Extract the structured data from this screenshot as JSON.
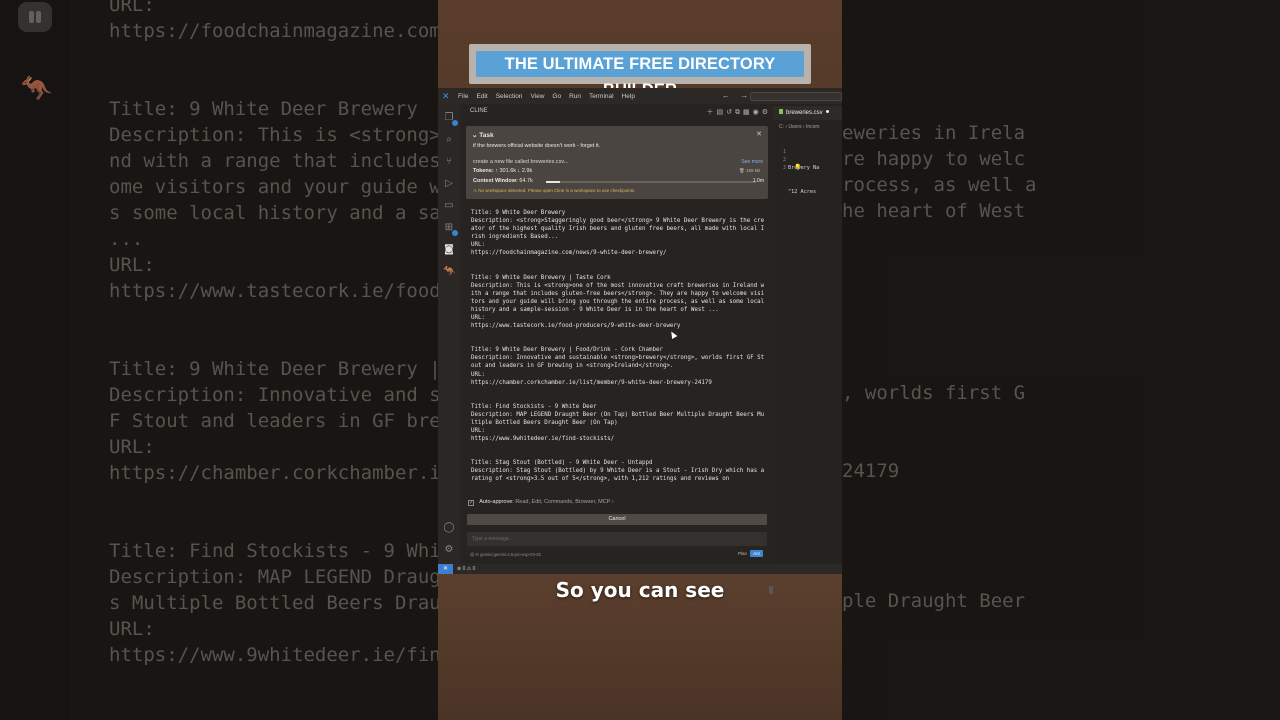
{
  "headline": "THE ULTIMATE FREE DIRECTORY BUILDER",
  "caption": "So you can see",
  "background": {
    "left_lines": [
      "URL:",
      "https://foodchainmagazine.com",
      "",
      "",
      "Title: 9 White Deer Brewery",
      "Description: This is <strong>",
      "nd with a range that includes",
      "ome visitors and your guide w",
      "s some local history and a sa",
      "...",
      "URL:",
      "https://www.tastecork.ie/food",
      "",
      "",
      "Title: 9 White Deer Brewery |",
      "Description: Innovative and s",
      "F Stout and leaders in GF bre",
      "URL:",
      "https://chamber.corkchamber.i",
      "",
      "",
      "Title: Find Stockists - 9 Whi",
      "Description: MAP LEGEND Draug",
      "s Multiple Bottled Beers Drau",
      "URL:",
      "https://www.9whitedeer.ie/fin"
    ],
    "right_lines": [
      "eweries in Irela",
      "re happy to welc",
      "rocess, as well a",
      "he heart of West",
      "",
      "",
      "",
      "",
      "",
      "",
      ", worlds first G",
      "",
      "",
      "24179",
      "",
      "",
      "",
      "",
      "ple Draught Beer"
    ]
  },
  "menubar": {
    "items": [
      "File",
      "Edit",
      "Selection",
      "View",
      "Go",
      "Run",
      "Terminal",
      "Help"
    ],
    "nav_arrows": "← →"
  },
  "panel": {
    "title": "CLINE"
  },
  "task": {
    "header": "Task",
    "description": "if the brewers official website doesn't work - forget it.",
    "subtask": "create a new file called breweries.csv...",
    "see_more": "See more",
    "tokens_label": "Tokens:",
    "tokens_up": "↑ 301.6k",
    "tokens_down": "↓ 2.9k",
    "cache": "159 kB",
    "context_label": "Context Window:",
    "context_used": "64.7k",
    "context_max": "1.0m",
    "context_fraction": 0.065,
    "warning": "⚠ No workspace detected. Please open Cline in a workspace to use checkpoints."
  },
  "results": [
    {
      "title": "Title: 9 White Deer Brewery",
      "description": "Description: <strong>Staggeringly good beer</strong> 9 White Deer Brewery is the creator of the highest quality Irish beers and gluten free beers, all made with local Irish ingredients Based...",
      "url_label": "URL:",
      "url": "https://foodchainmagazine.com/news/9-white-deer-brewery/"
    },
    {
      "title": "Title: 9 White Deer Brewery | Taste Cork",
      "description": "Description: This is <strong>one of the most innovative craft breweries in Ireland with a range that includes gluten-free beers</strong>. They are happy to welcome visitors and your guide will bring you through the entire process, as well as some local history and a sample-session - 9 White Deer is in the heart of West ...",
      "url_label": "URL:",
      "url": "https://www.tastecork.ie/food-producers/9-white-deer-brewery"
    },
    {
      "title": "Title: 9 White Deer Brewery | Food/Drink - Cork Chamber",
      "description": "Description: Innovative and sustainable <strong>brewery</strong>, worlds first GF Stout and leaders in GF brewing in <strong>Ireland</strong>.",
      "url_label": "URL:",
      "url": "https://chamber.corkchamber.ie/list/member/9-white-deer-brewery-24179"
    },
    {
      "title": "Title: Find Stockists - 9 White Deer",
      "description": "Description: MAP LEGEND Draught Beer (On Tap) Bottled Beer Multiple Draught Beers Multiple Bottled Beers Draught Beer (On Tap)",
      "url_label": "URL:",
      "url": "https://www.9whitedeer.ie/find-stockists/"
    },
    {
      "title": "Title: Stag Stout (Bottled) - 9 White Deer - Untappd",
      "description": "Description: Stag Stout (Bottled) by 9 White Deer is a Stout - Irish Dry which has a rating of <strong>3.5 out of 5</strong>, with 1,212 ratings and reviews on",
      "url_label": "",
      "url": ""
    }
  ],
  "auto_approve": {
    "label": "Auto-approve:",
    "options": "Read, Edit, Commands, Browser, MCP",
    "chevron": "›"
  },
  "cancel_label": "Cancel",
  "message_placeholder": "Type a message...",
  "model": "gemini:gemini-2.5-pro-exp-03-25",
  "plan_label": "Plan",
  "act_label": "Act",
  "editor": {
    "tab_label": "breweries.csv",
    "breadcrumb": "C: › Users › Incom",
    "line_numbers": [
      "1",
      "2",
      "3"
    ],
    "lines": [
      "Brewery Na",
      "\"12 Acres",
      ""
    ]
  },
  "statusbar": {
    "problems": "⊗ 0 ⚠ 0"
  }
}
